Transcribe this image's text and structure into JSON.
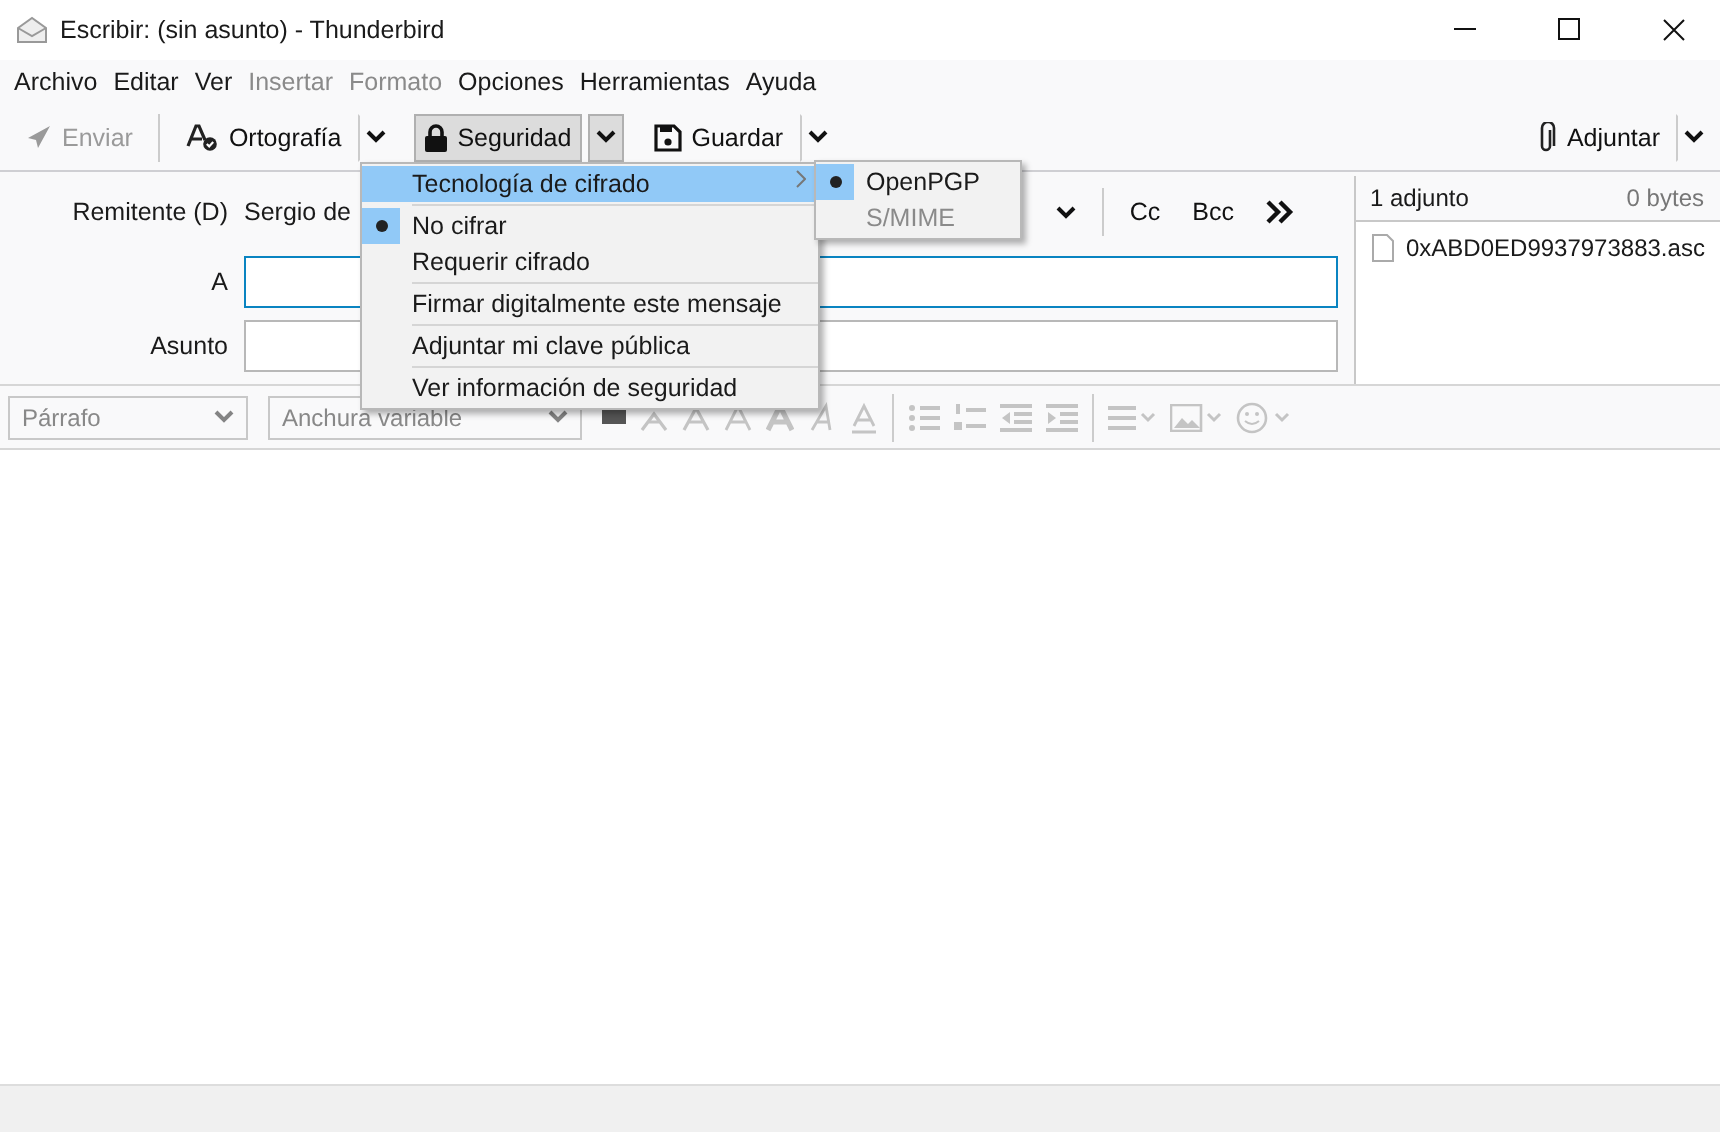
{
  "window": {
    "title": "Escribir: (sin asunto) - Thunderbird"
  },
  "menu_bar": [
    {
      "label": "Archivo",
      "disabled": false
    },
    {
      "label": "Editar",
      "disabled": false
    },
    {
      "label": "Ver",
      "disabled": false
    },
    {
      "label": "Insertar",
      "disabled": true
    },
    {
      "label": "Formato",
      "disabled": true
    },
    {
      "label": "Opciones",
      "disabled": false
    },
    {
      "label": "Herramientas",
      "disabled": false
    },
    {
      "label": "Ayuda",
      "disabled": false
    }
  ],
  "toolbar": {
    "left": [
      {
        "kind": "send",
        "label": "Enviar",
        "disabled": true,
        "pressed": false,
        "dropdown": false
      },
      {
        "kind": "spelling",
        "label": "Ortografía",
        "disabled": false,
        "pressed": false,
        "dropdown": true
      },
      {
        "kind": "lock",
        "label": "Seguridad",
        "disabled": false,
        "pressed": true,
        "dropdown": true
      },
      {
        "kind": "save",
        "label": "Guardar",
        "disabled": false,
        "pressed": false,
        "dropdown": true
      }
    ],
    "right": [
      {
        "kind": "clip",
        "label": "Adjuntar",
        "disabled": false,
        "pressed": false,
        "dropdown": true
      }
    ]
  },
  "header": {
    "from_label": "Remitente (D)",
    "from_value": "Sergio de",
    "to_label": "A",
    "to_focused": true,
    "subject_label": "Asunto",
    "recipient_buttons": [
      "Cc",
      "Bcc"
    ]
  },
  "attachments": {
    "count": "1 adjunto",
    "size": "0 bytes",
    "files": [
      "0xABD0ED9937973883.asc"
    ]
  },
  "format_toolbar": {
    "paragraph": "Párrafo",
    "font": "Anchura variable"
  },
  "security_menu": {
    "items": [
      {
        "kind": "submenu",
        "label": "Tecnología de cifrado",
        "highlighted": true
      },
      {
        "kind": "separator"
      },
      {
        "kind": "radio",
        "label": "No cifrar",
        "selected": true
      },
      {
        "kind": "radio",
        "label": "Requerir cifrado",
        "selected": false
      },
      {
        "kind": "separator"
      },
      {
        "kind": "item",
        "label": "Firmar digitalmente este mensaje"
      },
      {
        "kind": "separator"
      },
      {
        "kind": "item",
        "label": "Adjuntar mi clave pública"
      },
      {
        "kind": "separator"
      },
      {
        "kind": "item",
        "label": "Ver información de seguridad"
      }
    ]
  },
  "submenu": {
    "items": [
      {
        "label": "OpenPGP",
        "selected": true,
        "disabled": false
      },
      {
        "label": "S/MIME",
        "selected": false,
        "disabled": true
      }
    ]
  }
}
